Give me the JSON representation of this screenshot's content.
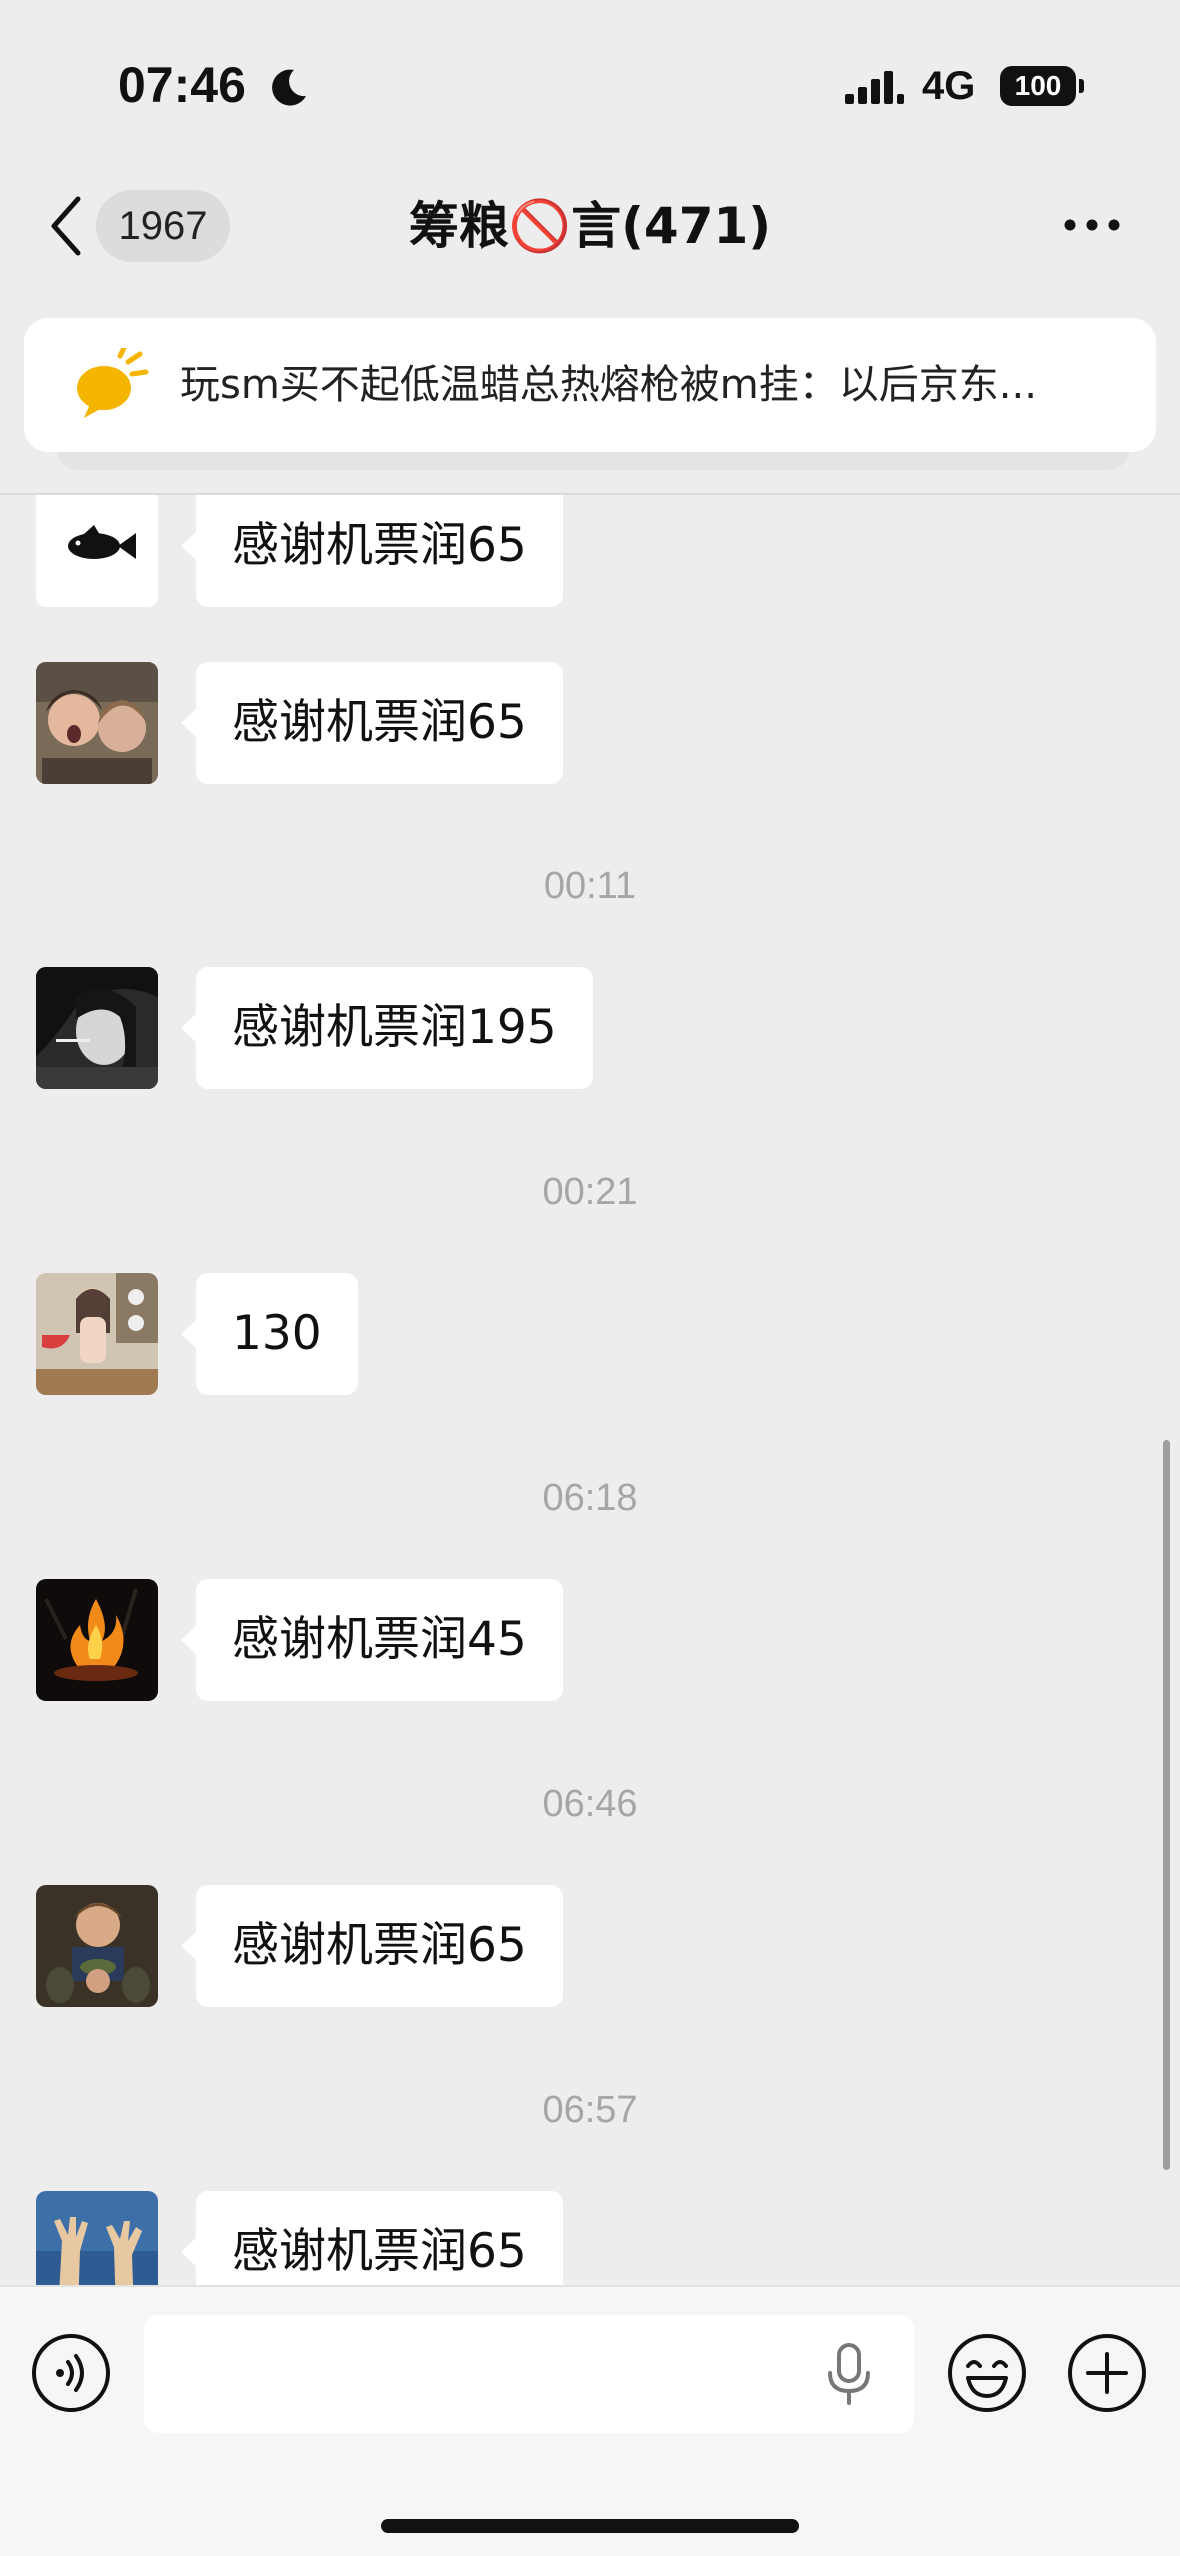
{
  "status_bar": {
    "time": "07:46",
    "network": "4G",
    "battery": "100",
    "icons": [
      "moon-icon",
      "signal-icon"
    ]
  },
  "nav": {
    "back_count": "1967",
    "title": "筹粮🚫言(471)",
    "icons": [
      "back-chevron-icon",
      "more-icon"
    ]
  },
  "notice": {
    "text": "玩sm买不起低温蜡总热熔枪被m挂：以后京东...",
    "icon": "megaphone-icon",
    "icon_color": "#f4b400"
  },
  "messages": [
    {
      "type": "message",
      "avatar": "fish",
      "text": "感谢机票润65"
    },
    {
      "type": "message",
      "avatar": "two-people",
      "text": "感谢机票润65"
    },
    {
      "type": "time",
      "text": "00:11"
    },
    {
      "type": "message",
      "avatar": "smoking-girl",
      "text": "感谢机票润195"
    },
    {
      "type": "time",
      "text": "00:21"
    },
    {
      "type": "message",
      "avatar": "woman-watermelon",
      "text": "130"
    },
    {
      "type": "time",
      "text": "06:18"
    },
    {
      "type": "message",
      "avatar": "campfire",
      "text": "感谢机票润45"
    },
    {
      "type": "time",
      "text": "06:46"
    },
    {
      "type": "message",
      "avatar": "soldiers",
      "text": "感谢机票润65"
    },
    {
      "type": "time",
      "text": "06:57"
    },
    {
      "type": "message",
      "avatar": "raised-hands",
      "text": "感谢机票润65"
    }
  ],
  "input_bar": {
    "text_value": "",
    "icons": [
      "voice-icon",
      "microphone-icon",
      "emoji-icon",
      "plus-icon"
    ]
  },
  "colors": {
    "background": "#ededed",
    "bubble": "#ffffff",
    "timestamp": "#a6a6a6"
  }
}
